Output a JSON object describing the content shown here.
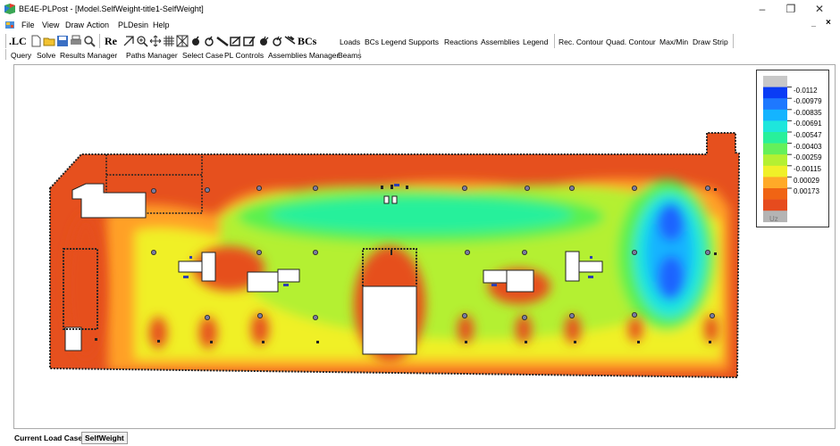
{
  "window": {
    "title": "BE4E-PLPost - [Model.SelfWeight-title1-SelfWeight]",
    "minimize": "–",
    "maximize": "❐",
    "close": "✕",
    "mdi_minimize": "_ ",
    "mdi_restore": "🗗",
    "mdi_close": "×"
  },
  "menu": [
    "File",
    "View",
    "Draw",
    "Action",
    "PLDesin",
    "Help"
  ],
  "toolbar1": {
    "lc": ".LC",
    "re": "Re",
    "bcs": "BCs",
    "buttons": [
      "Loads",
      "BCs Legend",
      "Supports",
      "Reactions",
      "Assemblies",
      "Legend",
      "Rec. Contour",
      "Quad. Contour",
      "Max/Min",
      "Draw Strip"
    ],
    "active": "Legend"
  },
  "toolbar2": [
    "Query",
    "Solve",
    "Results Manager",
    "Paths Manager",
    "Select Case",
    "PL Controls",
    "Assemblies Manager",
    "Beams"
  ],
  "legend": {
    "unit": "Uz",
    "values": [
      "-0.0112",
      "-0.00979",
      "-0.00835",
      "-0.00691",
      "-0.00547",
      "-0.00403",
      "-0.00259",
      "-0.00115",
      "0.00029",
      "0.00173"
    ],
    "colors": [
      "#c8c8c8",
      "#0a3cf5",
      "#1e78ff",
      "#14b4ff",
      "#1ee6dc",
      "#28f09b",
      "#64f05a",
      "#b4f032",
      "#f0f028",
      "#ffaa28",
      "#f06414",
      "#e64b1e",
      "#b4b4b4"
    ]
  },
  "contour_colors": {
    "red": "#e6501e",
    "orange": "#ffa028",
    "yellow": "#f0f028",
    "lime": "#b4f032",
    "green": "#5af050",
    "mint": "#28f09b",
    "cyan": "#1ee6dc",
    "sky": "#14b4ff",
    "blue": "#1e64ff"
  },
  "status": {
    "label": "Current Load Case:",
    "value": "SelfWeight"
  }
}
